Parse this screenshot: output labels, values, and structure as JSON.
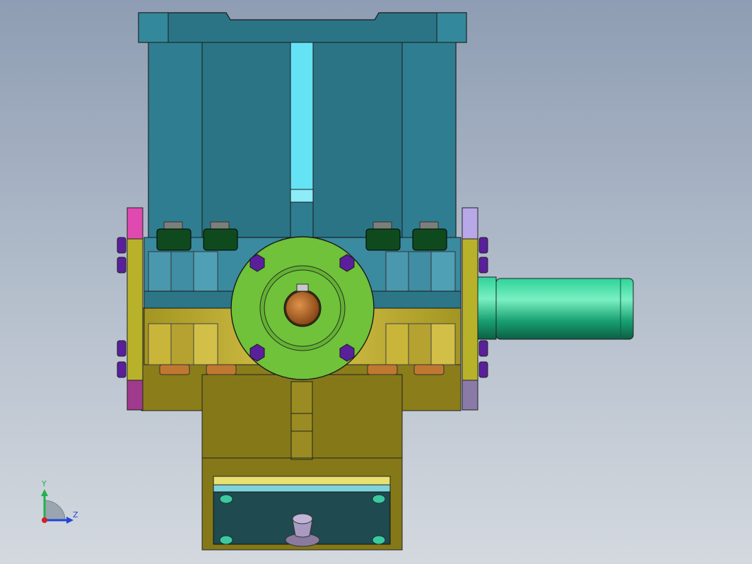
{
  "viewport": {
    "background_top": "#8e9db3",
    "background_bottom": "#d4d9df"
  },
  "triad": {
    "y_label": "Y",
    "z_label": "Z",
    "y_color": "#1fb34a",
    "z_color": "#1f47d6",
    "x_color": "#d62020"
  },
  "colors": {
    "housing_teal": "#2b7486",
    "housing_teal_light": "#3a8aa0",
    "slot_cyan": "#64e3f5",
    "base_olive": "#8a7d1a",
    "flange_green": "#6fc23a",
    "shaft_teal_green": "#1ea87a",
    "bolt_purple": "#5a1f9a",
    "nut_dark_green": "#0f4a1e",
    "nut_orange": "#c07830",
    "bore_bronze": "#b86a28",
    "side_plate_pink": "#e04ab0",
    "side_plate_lavender": "#b8a8e8",
    "bottom_cover_dark": "#1e4a50"
  },
  "model": {
    "parts": [
      "top-housing",
      "center-slot",
      "left-side-plate",
      "right-side-plate",
      "front-flange",
      "output-shaft",
      "bottom-cover-plate",
      "breather-knob"
    ]
  }
}
